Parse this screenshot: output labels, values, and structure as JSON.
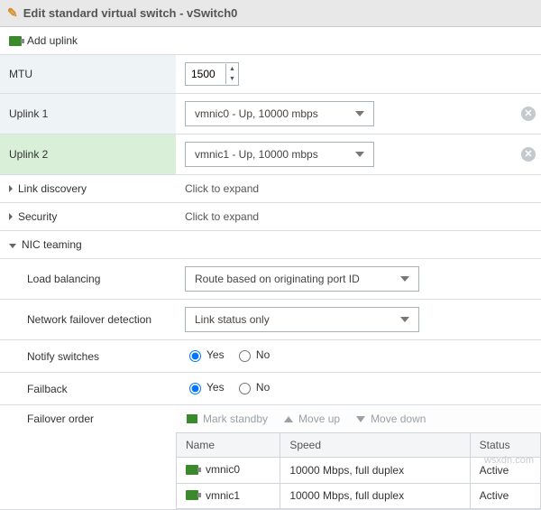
{
  "dialog": {
    "title": "Edit standard virtual switch - vSwitch0"
  },
  "addUplink": {
    "label": "Add uplink"
  },
  "fields": {
    "mtu": {
      "label": "MTU",
      "value": "1500"
    },
    "uplink1": {
      "label": "Uplink 1",
      "value": "vmnic0 - Up, 10000 mbps"
    },
    "uplink2": {
      "label": "Uplink 2",
      "value": "vmnic1 - Up, 10000 mbps"
    },
    "linkDiscovery": {
      "label": "Link discovery",
      "value": "Click to expand"
    },
    "security": {
      "label": "Security",
      "value": "Click to expand"
    },
    "nicTeaming": {
      "label": "NIC teaming"
    },
    "loadBalancing": {
      "label": "Load balancing",
      "value": "Route based on originating port ID"
    },
    "failoverDetection": {
      "label": "Network failover detection",
      "value": "Link status only"
    },
    "notifySwitches": {
      "label": "Notify switches"
    },
    "failback": {
      "label": "Failback"
    },
    "failoverOrder": {
      "label": "Failover order"
    }
  },
  "yesNo": {
    "yes": "Yes",
    "no": "No"
  },
  "failoverToolbar": {
    "markStandby": "Mark standby",
    "moveUp": "Move up",
    "moveDown": "Move down"
  },
  "gridHeaders": {
    "name": "Name",
    "speed": "Speed",
    "status": "Status"
  },
  "nics": [
    {
      "name": "vmnic0",
      "speed": "10000 Mbps, full duplex",
      "status": "Active"
    },
    {
      "name": "vmnic1",
      "speed": "10000 Mbps, full duplex",
      "status": "Active"
    }
  ],
  "watermark": "wsxdn.com"
}
